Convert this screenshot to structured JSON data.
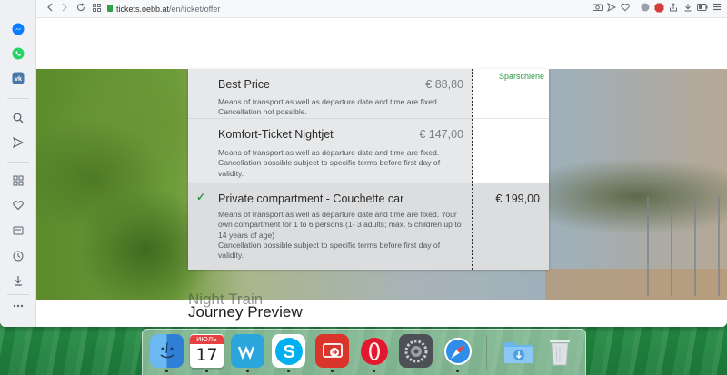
{
  "browser": {
    "url_host": "tickets.oebb.at",
    "url_path": "/en/ticket/offer"
  },
  "sidebar": {
    "items": [
      {
        "icon": "messenger-icon",
        "color": "#0a7cff"
      },
      {
        "icon": "whatsapp-icon",
        "color": "#25d366"
      },
      {
        "icon": "vk-icon",
        "color": "#4a76a8"
      }
    ]
  },
  "offers": [
    {
      "name": "Best Price",
      "price": "€ 88,80",
      "description": "Means of transport as well as departure date and time are fixed. Cancellation not possible.",
      "selected": false
    },
    {
      "name": "Komfort-Ticket Nightjet",
      "price": "€ 147,00",
      "description": "Means of transport as well as departure date and time are fixed. Cancellation possible subject to specific terms before first day of validity.",
      "selected": false
    },
    {
      "name": "Private compartment - Couchette car",
      "price": "",
      "description": "Means of transport as well as departure date and time are fixed. Your own compartment for 1 to 6 persons (1- 3 adults; max. 5 children up to 14 years of age)",
      "description2": "Cancellation possible subject to specific terms before first day of validity.",
      "selected": true
    }
  ],
  "side": {
    "tag": "Sparschiene",
    "selected_price": "€ 199,00"
  },
  "headings": {
    "night_train": "Night Train",
    "journey_preview": "Journey Preview"
  },
  "dock": {
    "calendar_month": "ИЮЛЬ",
    "calendar_day": "17",
    "apps": [
      "finder",
      "calendar",
      "wunderlist",
      "skype",
      "remote-desktop",
      "opera",
      "system-preferences",
      "safari",
      "downloads",
      "trash"
    ]
  },
  "colors": {
    "accent_green": "#2f9a46",
    "offer_bg": "#e7e8ea",
    "selected_bg": "#dcdddf"
  }
}
